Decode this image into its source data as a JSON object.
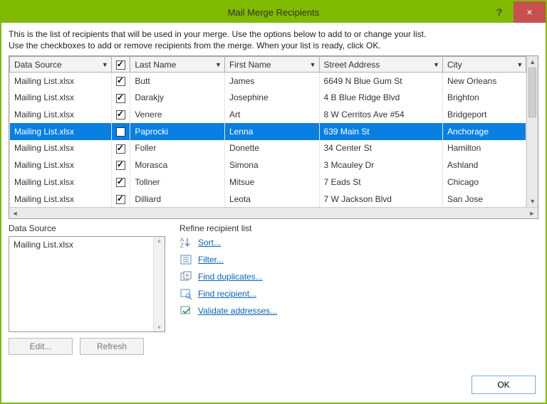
{
  "window": {
    "title": "Mail Merge Recipients",
    "help": "?",
    "close": "×"
  },
  "instructions": {
    "line1": "This is the list of recipients that will be used in your merge.  Use the options below to add to or change your list.",
    "line2": "Use the checkboxes to add or remove recipients from the merge.  When your list is ready, click OK."
  },
  "columns": {
    "data_source": "Data Source",
    "checkbox": "",
    "last_name": "Last Name",
    "first_name": "First Name",
    "street_address": "Street Address",
    "city": "City"
  },
  "rows": [
    {
      "source": "Mailing List.xlsx",
      "checked": true,
      "last": "Butt",
      "first": "James",
      "addr": "6649 N Blue Gum St",
      "city": "New Orleans",
      "selected": false
    },
    {
      "source": "Mailing List.xlsx",
      "checked": true,
      "last": "Darakjy",
      "first": "Josephine",
      "addr": "4 B Blue Ridge Blvd",
      "city": "Brighton",
      "selected": false
    },
    {
      "source": "Mailing List.xlsx",
      "checked": true,
      "last": "Venere",
      "first": "Art",
      "addr": "8 W Cerritos Ave #54",
      "city": "Bridgeport",
      "selected": false
    },
    {
      "source": "Mailing List.xlsx",
      "checked": false,
      "last": "Paprocki",
      "first": "Lenna",
      "addr": "639 Main St",
      "city": "Anchorage",
      "selected": true
    },
    {
      "source": "Mailing List.xlsx",
      "checked": true,
      "last": "Foller",
      "first": "Donette",
      "addr": "34 Center St",
      "city": "Hamilton",
      "selected": false
    },
    {
      "source": "Mailing List.xlsx",
      "checked": true,
      "last": "Morasca",
      "first": "Simona",
      "addr": "3 Mcauley Dr",
      "city": "Ashland",
      "selected": false
    },
    {
      "source": "Mailing List.xlsx",
      "checked": true,
      "last": "Tollner",
      "first": "Mitsue",
      "addr": "7 Eads St",
      "city": "Chicago",
      "selected": false
    },
    {
      "source": "Mailing List.xlsx",
      "checked": true,
      "last": "Dilliard",
      "first": "Leota",
      "addr": "7 W Jackson Blvd",
      "city": "San Jose",
      "selected": false
    }
  ],
  "datasource_panel": {
    "label": "Data Source",
    "items": [
      "Mailing List.xlsx"
    ],
    "edit_label": "Edit...",
    "refresh_label": "Refresh"
  },
  "refine_panel": {
    "label": "Refine recipient list",
    "sort": "Sort...",
    "filter": "Filter...",
    "find_duplicates": "Find duplicates...",
    "find_recipient": "Find recipient...",
    "validate": "Validate addresses..."
  },
  "buttons": {
    "ok": "OK"
  },
  "colors": {
    "accent": "#7fba00",
    "selection": "#0a7fe2",
    "link": "#0a63b3",
    "close": "#c75050"
  }
}
